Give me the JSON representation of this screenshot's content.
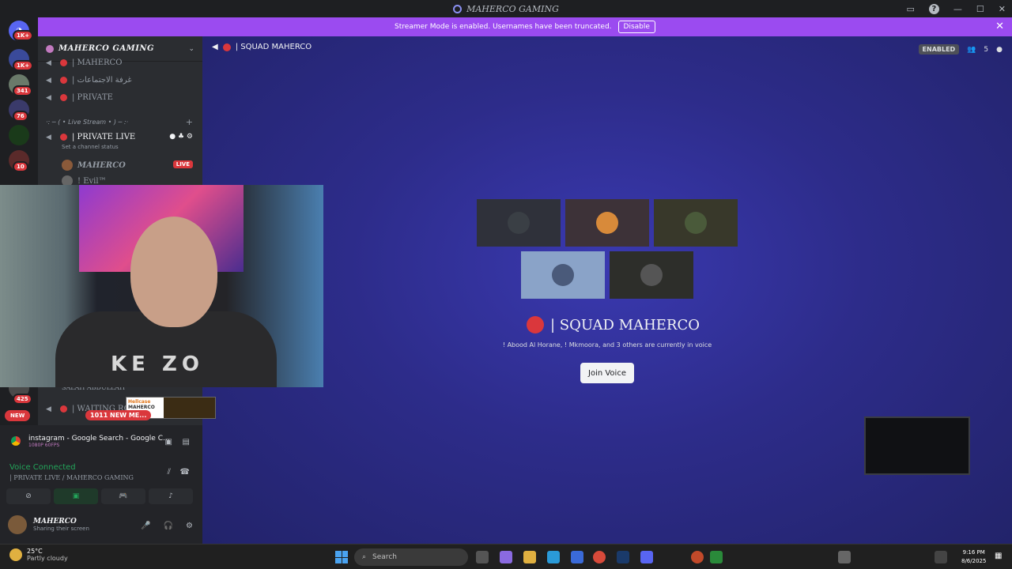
{
  "window": {
    "title": "MAHERCO GAMING"
  },
  "banner": {
    "text": "Streamer Mode is enabled. Usernames have been truncated.",
    "button": "Disable"
  },
  "rail": {
    "badges": [
      "1K+",
      "1K+",
      "341",
      "76",
      "10",
      "425"
    ],
    "new_label": "NEW"
  },
  "sidebar": {
    "server_name": "MAHERCO GAMING",
    "channels": [
      "| MAHERCO",
      "| غرفة الاجتماعات",
      "| PRIVATE"
    ],
    "category": "·: ─ ( • Live Stream • ) ─ :·",
    "active_channel": "| PRIVATE LIVE",
    "status_hint": "Set a channel status",
    "members": [
      "MAHERCO",
      "! Evil™"
    ],
    "live_badge": "LIVE",
    "lower_member": "SALAH ABDULLAH",
    "waiting_channel": "| WAITING RO...",
    "new_messages": "1011 NEW ME..."
  },
  "stream_panel": {
    "title": "instagram - Google Search - Google C...",
    "quality": "1080P 60FPS"
  },
  "voice": {
    "status": "Voice Connected",
    "location": "| PRIVATE LIVE / MAHERCO GAMING"
  },
  "user": {
    "name": "MAHERCO",
    "status": "Sharing their screen"
  },
  "main": {
    "channel": "| SQUAD MAHERCO",
    "enabled": "ENABLED",
    "member_count": "5",
    "heading": "| SQUAD MAHERCO",
    "subtitle": "! Abood Al Horane, ! Mkmoora, and 3 others are currently in voice",
    "join": "Join Voice"
  },
  "webcam": {
    "shirt_text": "KE ZO"
  },
  "promo": {
    "brand": "Hellcase",
    "code": "MAHERCO"
  },
  "taskbar": {
    "temp": "25°C",
    "weather": "Partly cloudy",
    "search": "Search",
    "time": "9:16 PM",
    "date": "8/6/2025"
  }
}
